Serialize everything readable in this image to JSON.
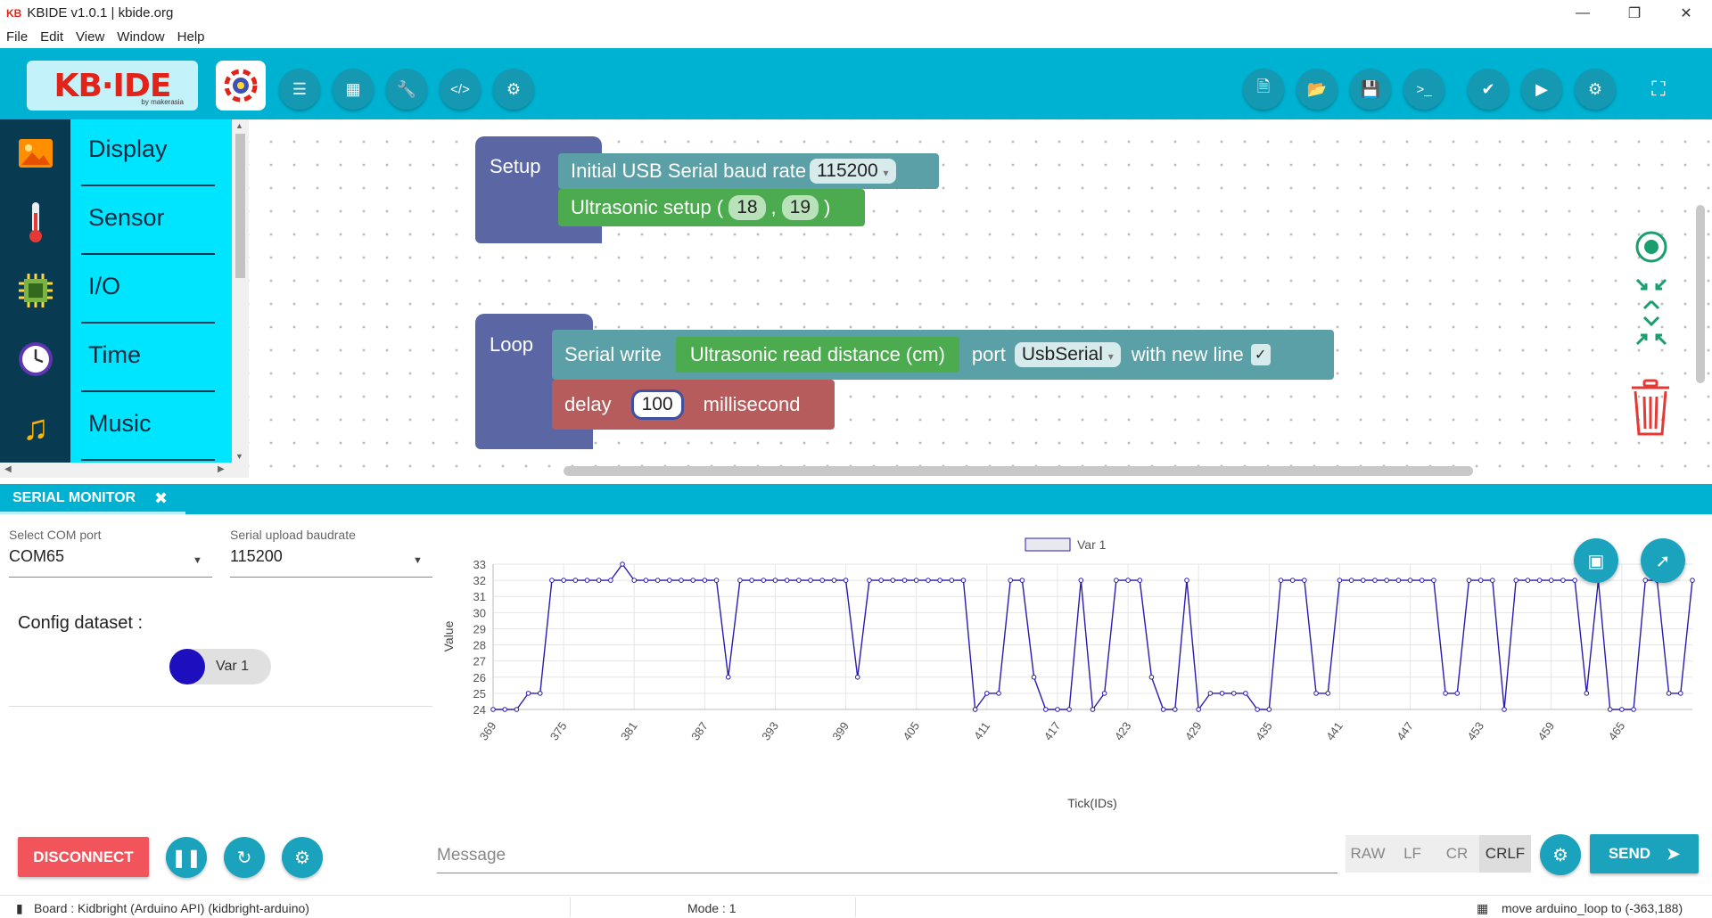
{
  "window": {
    "title": "KBIDE v1.0.1 | kbide.org",
    "app_badge": "KB"
  },
  "menu": [
    "File",
    "Edit",
    "View",
    "Window",
    "Help"
  ],
  "toolbar": {
    "logo_text": "KB·IDE",
    "logo_sub": "by makerasia"
  },
  "categories": [
    {
      "label": "Display",
      "icon": "image-icon",
      "color": "#ff8f00"
    },
    {
      "label": "Sensor",
      "icon": "thermometer-icon",
      "color": "#e53935"
    },
    {
      "label": "I/O",
      "icon": "chip-icon",
      "color": "#7cb342"
    },
    {
      "label": "Time",
      "icon": "clock-icon",
      "color": "#5e35b1"
    },
    {
      "label": "Music",
      "icon": "music-icon",
      "color": "#ffb300"
    }
  ],
  "blocks": {
    "setup_label": "Setup",
    "baud_text": "Initial USB Serial baud rate",
    "baud_value": "115200",
    "ultra_setup": "Ultrasonic setup (",
    "ultra_p1": "18",
    "ultra_comma": ",",
    "ultra_p2": "19",
    "ultra_close": ")",
    "loop_label": "Loop",
    "serial_write": "Serial write",
    "ultra_read": "Ultrasonic read distance (cm)",
    "port": "port",
    "port_value": "UsbSerial",
    "newline": "with new line",
    "check": "✓",
    "delay": "delay",
    "delay_value": "100",
    "ms": "millisecond"
  },
  "serial": {
    "tab": "SERIAL MONITOR",
    "com_caption": "Select COM port",
    "com_value": "COM65",
    "baud_caption": "Serial upload baudrate",
    "baud_value": "115200",
    "config_label": "Config dataset :",
    "dataset_chip": "Var 1",
    "message_placeholder": "Message",
    "line_endings": [
      "RAW",
      "LF",
      "CR",
      "CRLF"
    ],
    "line_ending_selected": "CRLF",
    "disconnect": "DISCONNECT",
    "send": "SEND"
  },
  "status": {
    "board": "Board : Kidbright (Arduino API) (kidbright-arduino)",
    "mode": "Mode : 1",
    "action": "move arduino_loop to (-363,188)"
  },
  "colors": {
    "accent": "#00b2d1",
    "category_bg": "#00e5ff",
    "series": "#1e0fbe"
  },
  "chart_data": {
    "type": "line",
    "xlabel": "Tick(IDs)",
    "ylabel": "Value",
    "ylim": [
      24,
      33
    ],
    "legend": "top",
    "series": [
      {
        "name": "Var 1",
        "color": "#2a1bb0"
      }
    ],
    "x_start": 369,
    "x_ticks": [
      369,
      375,
      381,
      387,
      393,
      399,
      405,
      411,
      417,
      423,
      429,
      435,
      441,
      447,
      453,
      459,
      465
    ],
    "y_ticks": [
      24,
      25,
      26,
      27,
      28,
      29,
      30,
      31,
      32,
      33
    ],
    "values": [
      24,
      24,
      24,
      25,
      25,
      32,
      32,
      32,
      32,
      32,
      32,
      33,
      32,
      32,
      32,
      32,
      32,
      32,
      32,
      32,
      26,
      32,
      32,
      32,
      32,
      32,
      32,
      32,
      32,
      32,
      32,
      26,
      32,
      32,
      32,
      32,
      32,
      32,
      32,
      32,
      32,
      24,
      25,
      25,
      32,
      32,
      26,
      24,
      24,
      24,
      32,
      24,
      25,
      32,
      32,
      32,
      26,
      24,
      24,
      32,
      24,
      25,
      25,
      25,
      25,
      24,
      24,
      32,
      32,
      32,
      25,
      25,
      32,
      32,
      32,
      32,
      32,
      32,
      32,
      32,
      32,
      25,
      25,
      32,
      32,
      32,
      24,
      32,
      32,
      32,
      32,
      32,
      32,
      25,
      32,
      24,
      24,
      24,
      32,
      32,
      25,
      25,
      32
    ]
  }
}
